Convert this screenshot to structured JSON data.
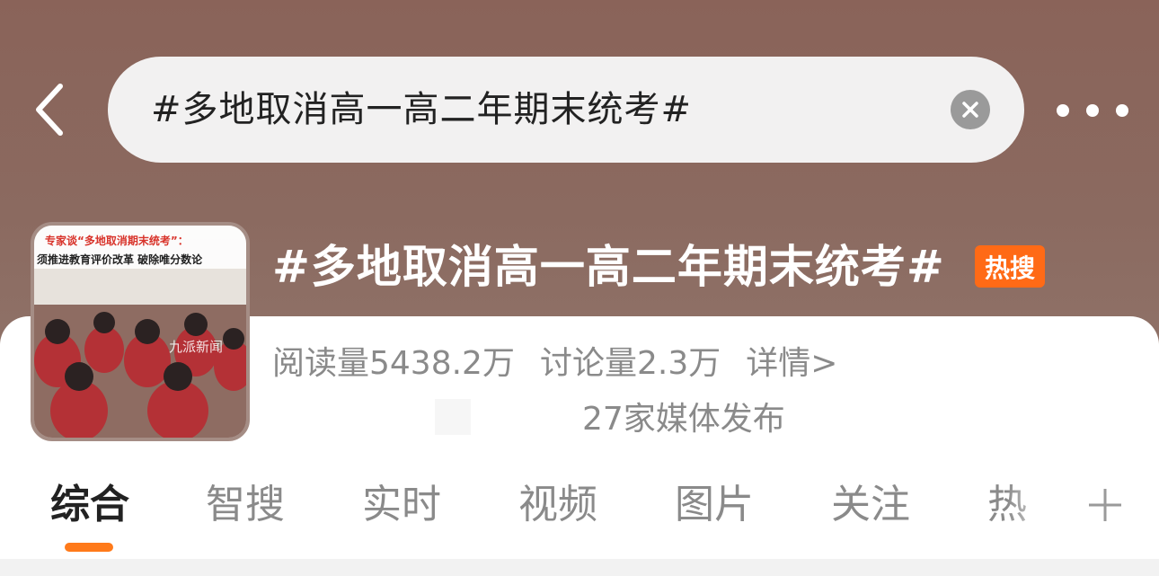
{
  "header": {
    "search_query": "#多地取消高一高二年期末统考#",
    "back_icon": "chevron-left-icon",
    "clear_icon": "close-icon",
    "more_icon": "more-dots-icon"
  },
  "topic": {
    "title": "#多地取消高一高二年期末统考#",
    "badge": "热搜",
    "thumbnail_caption_line1": "专家谈“多地取消期末统考”：",
    "thumbnail_caption_line2": "须推进教育评价改革 破除唯分数论",
    "thumbnail_watermark": "九派新闻",
    "reads": "阅读量5438.2万",
    "discussions": "讨论量2.3万",
    "detail_link": "详情>",
    "media_count": "27家媒体发布"
  },
  "tabs": [
    {
      "label": "综合",
      "active": true
    },
    {
      "label": "智搜"
    },
    {
      "label": "实时"
    },
    {
      "label": "视频"
    },
    {
      "label": "图片"
    },
    {
      "label": "关注"
    },
    {
      "label": "热"
    }
  ],
  "colors": {
    "accent": "#ff7a1a",
    "hot_badge": "#ff6a16",
    "header_bg": "#8a6359"
  }
}
